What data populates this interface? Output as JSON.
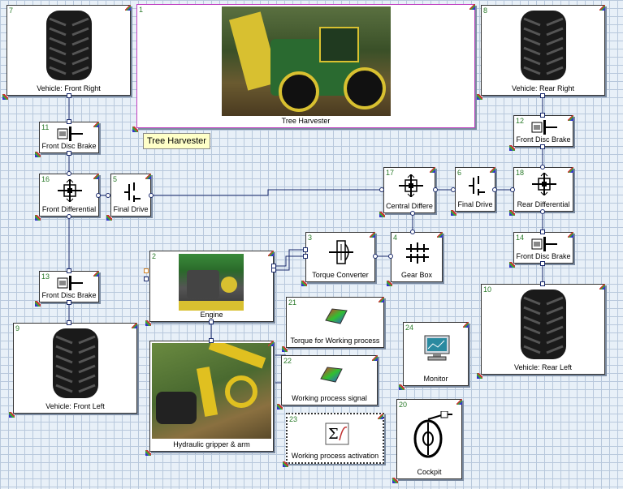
{
  "diagram": {
    "tag": "Tree Harvester",
    "blocks": {
      "b1": {
        "num": "1",
        "label": "Tree Harvester"
      },
      "b2": {
        "num": "2",
        "label": "Engine"
      },
      "b3": {
        "num": "3",
        "label": "Torque Converter"
      },
      "b4": {
        "num": "4",
        "label": "Gear Box"
      },
      "b5": {
        "num": "5",
        "label": "Final Drive"
      },
      "b6": {
        "num": "6",
        "label": "Final Drive"
      },
      "b7": {
        "num": "7",
        "label": "Vehicle: Front Right"
      },
      "b8": {
        "num": "8",
        "label": "Vehicle: Rear Right"
      },
      "b9": {
        "num": "9",
        "label": "Vehicle: Front Left"
      },
      "b10": {
        "num": "10",
        "label": "Vehicle: Rear Left"
      },
      "b11": {
        "num": "11",
        "label": "Front Disc Brake"
      },
      "b12": {
        "num": "12",
        "label": "Front Disc Brake"
      },
      "b13": {
        "num": "13",
        "label": "Front Disc Brake"
      },
      "b14": {
        "num": "14",
        "label": "Front Disc Brake"
      },
      "b16": {
        "num": "16",
        "label": "Front Differential"
      },
      "b17": {
        "num": "17",
        "label": "Central Differe"
      },
      "b18": {
        "num": "18",
        "label": "Rear Differential"
      },
      "b20": {
        "num": "20",
        "label": "Cockpit"
      },
      "b21": {
        "num": "21",
        "label": "Torque for Working process"
      },
      "b22": {
        "num": "22",
        "label": "Working process signal"
      },
      "b23": {
        "num": "23",
        "label": "Working process activation"
      },
      "b24": {
        "num": "24",
        "label": "Monitor"
      },
      "b19": {
        "label": "Hydraulic gripper & arm"
      }
    }
  }
}
